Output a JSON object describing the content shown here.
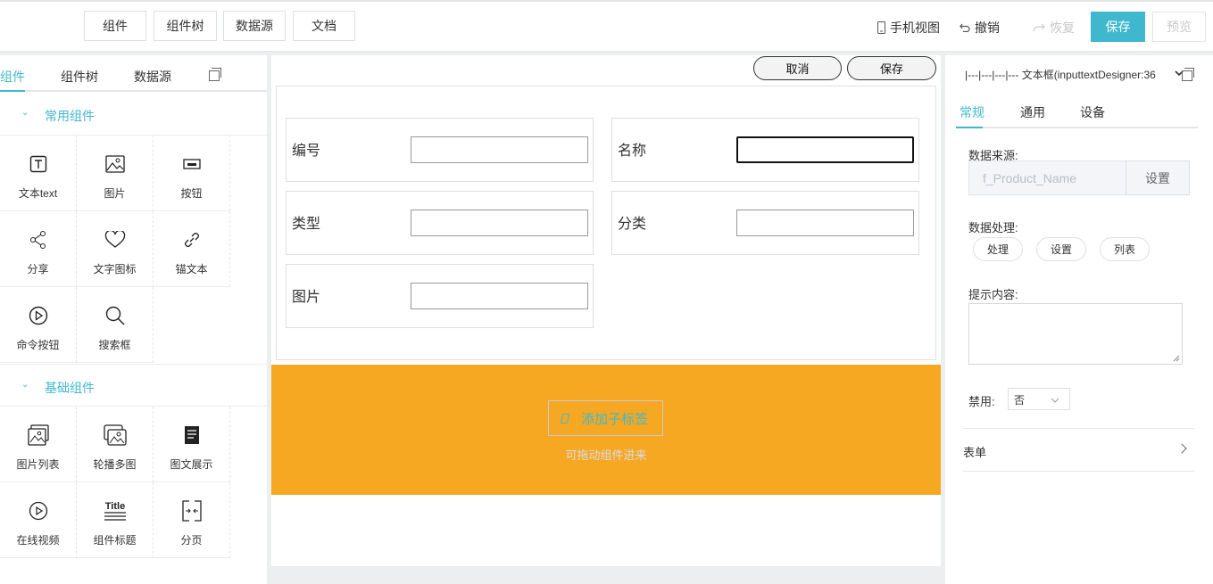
{
  "toolbar": {
    "tabs": [
      "组件",
      "组件树",
      "数据源",
      "文档"
    ],
    "mobile_view": "手机视图",
    "undo": "撤销",
    "redo": "恢复",
    "save": "保存",
    "preview": "预览"
  },
  "left": {
    "tabs": [
      "组件",
      "组件树",
      "数据源"
    ],
    "groups": [
      {
        "name": "常用组件",
        "items": [
          {
            "label": "文本text",
            "icon": "text-icon"
          },
          {
            "label": "图片",
            "icon": "image-icon"
          },
          {
            "label": "按钮",
            "icon": "button-icon"
          },
          {
            "label": "分享",
            "icon": "share-icon"
          },
          {
            "label": "文字图标",
            "icon": "heart-icon"
          },
          {
            "label": "锚文本",
            "icon": "link-icon"
          },
          {
            "label": "命令按钮",
            "icon": "play-circle-icon"
          },
          {
            "label": "搜索框",
            "icon": "search-icon"
          }
        ]
      },
      {
        "name": "基础组件",
        "items": [
          {
            "label": "图片列表",
            "icon": "image-list-icon"
          },
          {
            "label": "轮播多图",
            "icon": "carousel-icon"
          },
          {
            "label": "图文展示",
            "icon": "article-icon"
          },
          {
            "label": "在线视频",
            "icon": "video-icon"
          },
          {
            "label": "组件标题",
            "icon": "title-icon"
          },
          {
            "label": "分页",
            "icon": "pagination-icon"
          }
        ]
      }
    ]
  },
  "canvas": {
    "cancel": "取消",
    "save": "保存",
    "fields": [
      "编号",
      "名称",
      "类型",
      "分类",
      "图片"
    ],
    "add_tab": "添加子标签",
    "drag_tip": "可拖动组件进来"
  },
  "right": {
    "selected": "|---|---|---|--- 文本框(inputtextDesigner:36",
    "tabs": [
      "常规",
      "通用",
      "设备"
    ],
    "data_source_label": "数据来源:",
    "data_source_placeholder": "f_Product_Name",
    "set_button": "设置",
    "data_process_label": "数据处理:",
    "process_buttons": [
      "处理",
      "设置",
      "列表"
    ],
    "hint_label": "提示内容:",
    "disabled_label": "禁用:",
    "disabled_value": "否",
    "form_label": "表单"
  },
  "colors": {
    "accent": "#3fb8cf",
    "orange": "#f6a823"
  }
}
